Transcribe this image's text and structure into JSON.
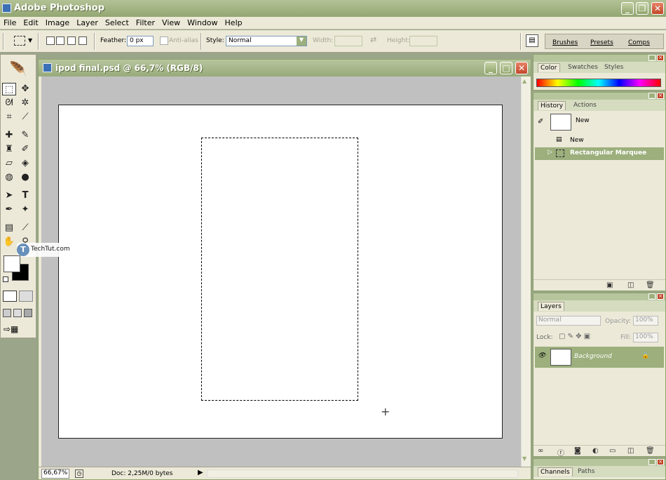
{
  "app": {
    "title": "Adobe Photoshop"
  },
  "menu": [
    "File",
    "Edit",
    "Image",
    "Layer",
    "Select",
    "Filter",
    "View",
    "Window",
    "Help"
  ],
  "options": {
    "feather_label": "Feather:",
    "feather_value": "0 px",
    "antialias_label": "Anti-alias",
    "style_label": "Style:",
    "style_value": "Normal",
    "width_label": "Width:",
    "height_label": "Height:"
  },
  "palette_well": [
    "Brushes",
    "Presets",
    "Comps"
  ],
  "document": {
    "title": "ipod final.psd @ 66,7% (RGB/8)",
    "zoom": "66,67%",
    "doc_info": "Doc: 2,25M/0 bytes"
  },
  "watermark": {
    "icon": "T",
    "text": "TechTut.com"
  },
  "color_palette": {
    "tabs": [
      "Color",
      "Swatches",
      "Styles"
    ]
  },
  "history_palette": {
    "tabs": [
      "History",
      "Actions"
    ],
    "snapshot": "New",
    "items": [
      {
        "label": "New",
        "selected": false
      },
      {
        "label": "Rectangular Marquee",
        "selected": true
      }
    ]
  },
  "layers_palette": {
    "tab": "Layers",
    "blend_mode": "Normal",
    "opacity_label": "Opacity:",
    "opacity_value": "100%",
    "lock_label": "Lock:",
    "fill_label": "Fill:",
    "fill_value": "100%",
    "layers": [
      {
        "name": "Background",
        "locked": true,
        "visible": true
      }
    ]
  },
  "channels_palette": {
    "tabs": [
      "Channels",
      "Paths"
    ]
  },
  "colors": {
    "accent": "#9caf7c",
    "titlebar": "#93a672",
    "close": "#c1462a"
  }
}
